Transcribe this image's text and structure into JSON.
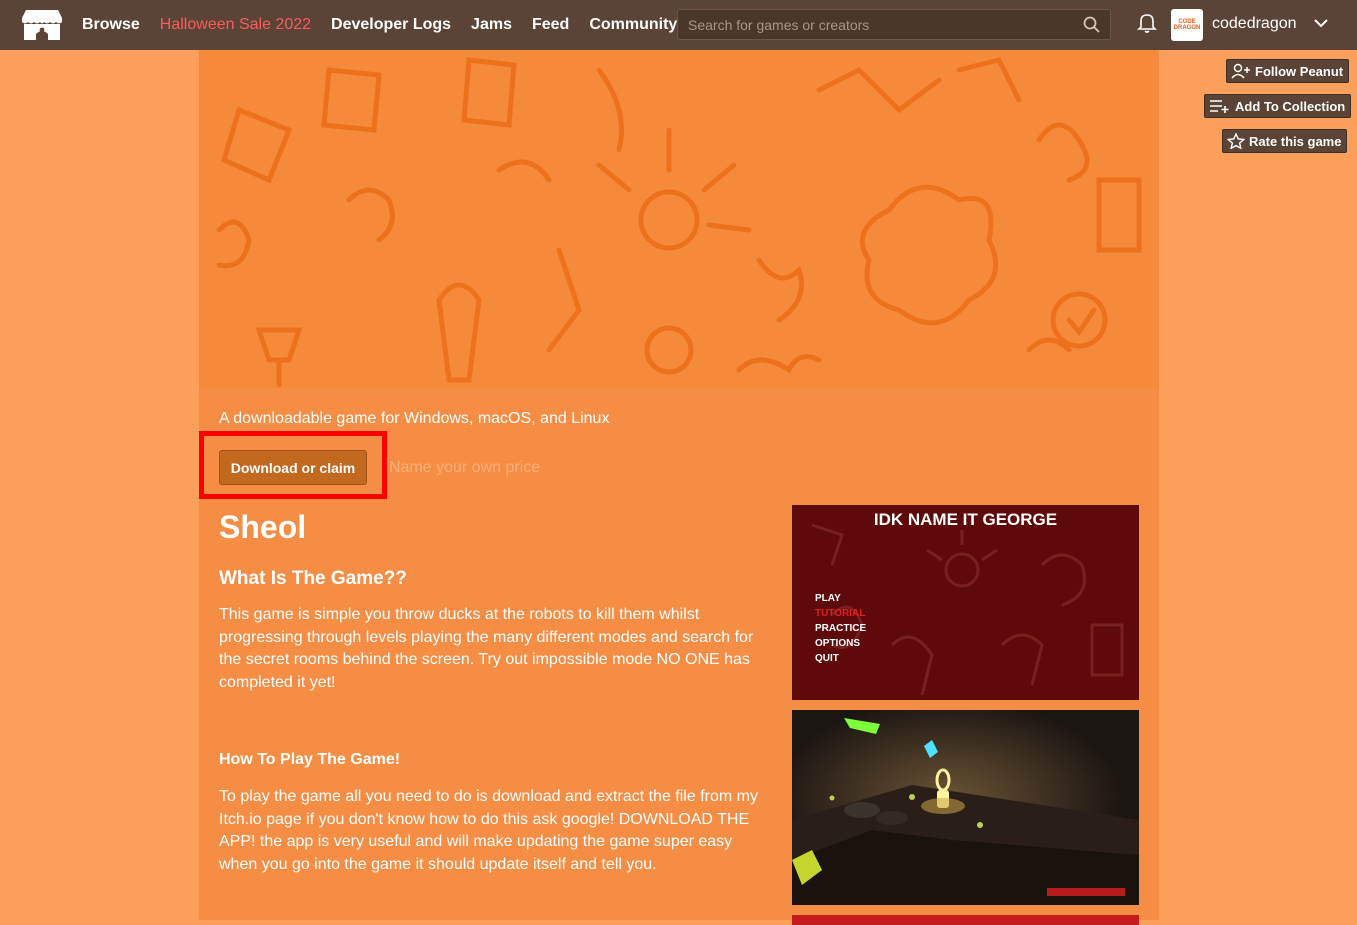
{
  "topbar": {
    "nav": {
      "browse": "Browse",
      "sale": "Halloween Sale 2022",
      "devlogs": "Developer Logs",
      "jams": "Jams",
      "feed": "Feed",
      "community": "Community"
    },
    "search_placeholder": "Search for games or creators",
    "avatar_text": "CODE DRAGON",
    "username": "codedragon"
  },
  "actions": {
    "follow": "Follow Peanut",
    "collection": "Add To Collection",
    "rate": "Rate this game"
  },
  "game": {
    "tagline": "A downloadable game for Windows, macOS, and Linux",
    "download_label": "Download or claim",
    "price_text": "Name your own price",
    "title": "Sheol",
    "section1_heading": "What Is The Game??",
    "section1_text": "This game is simple you throw ducks at the robots to kill them whilst progressing through levels playing the many different modes and search for the secret rooms behind the screen. Try out impossible mode NO ONE has completed it yet!",
    "section2_heading": "How To Play The Game!",
    "section2_text": "To play the game all you need to do is download and extract the file from my Itch.io page if you don't know how to do this ask google! DOWNLOAD THE APP! the app is very useful and will make updating the game super easy when you go into the game it should update itself and tell you."
  },
  "screenshot1": {
    "title": "IDK NAME IT GEORGE",
    "menu": [
      "PLAY",
      "TUTORIAL",
      "PRACTICE",
      "OPTIONS",
      "QUIT"
    ]
  },
  "colors": {
    "topbar": "#5b4435",
    "page_bg": "#fb9f5a",
    "column_bg": "#f58d45",
    "sale": "#fa5c5c",
    "download_btn": "#c3691f",
    "highlight": "#ff0000"
  },
  "icons": [
    "itchio-logo-icon",
    "search-icon",
    "bell-icon",
    "chevron-down-icon",
    "follow-user-icon",
    "add-collection-icon",
    "star-icon"
  ]
}
